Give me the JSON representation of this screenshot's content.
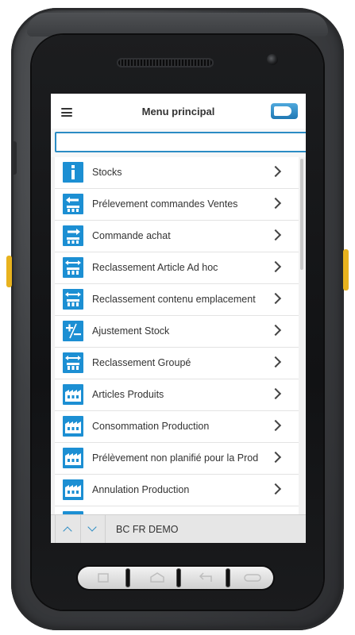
{
  "header": {
    "title": "Menu principal"
  },
  "search": {
    "value": "",
    "placeholder": ""
  },
  "menu": {
    "items": [
      {
        "label": "Stocks",
        "icon": "info-icon"
      },
      {
        "label": "Prélevement commandes Ventes",
        "icon": "pick-left-icon"
      },
      {
        "label": "Commande achat",
        "icon": "receive-right-icon"
      },
      {
        "label": "Reclassement Article Ad hoc",
        "icon": "transfer-icon"
      },
      {
        "label": "Reclassement contenu emplacement",
        "icon": "transfer-icon"
      },
      {
        "label": "Ajustement Stock",
        "icon": "plus-minus-icon"
      },
      {
        "label": "Reclassement Groupé",
        "icon": "transfer-icon"
      },
      {
        "label": "Articles Produits",
        "icon": "factory-icon"
      },
      {
        "label": "Consommation Production",
        "icon": "factory-icon"
      },
      {
        "label": "Prélèvement non planifié pour la Prod",
        "icon": "factory-icon"
      },
      {
        "label": "Annulation Production",
        "icon": "factory-icon"
      },
      {
        "label": "",
        "icon": "factory-icon"
      }
    ]
  },
  "footer": {
    "company": "BC FR DEMO"
  },
  "colors": {
    "accent": "#1c8fd3",
    "device_accent": "#e8b21e"
  }
}
